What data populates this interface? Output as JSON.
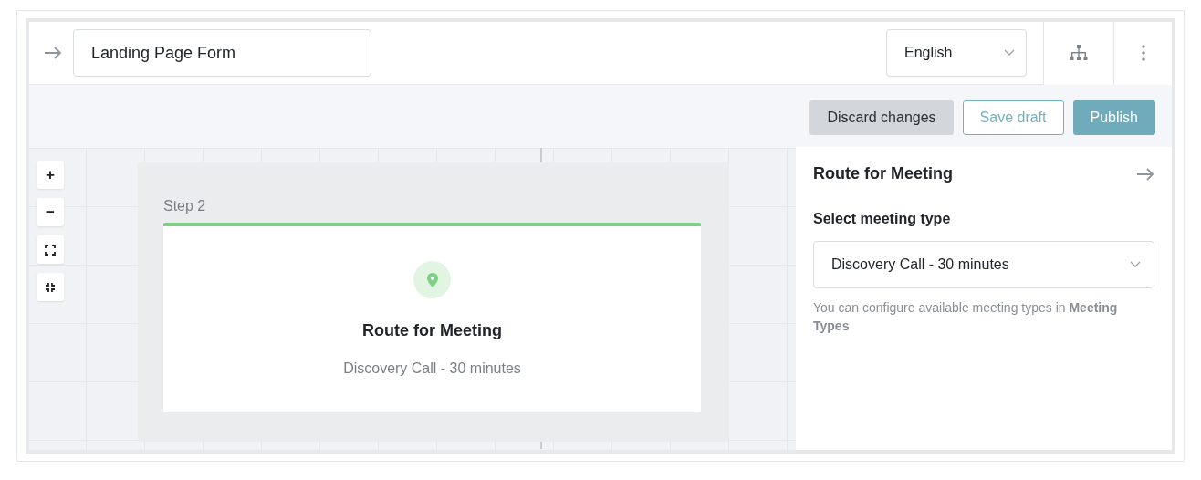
{
  "header": {
    "form_name": "Landing Page Form",
    "language": "English"
  },
  "toolbar": {
    "buttons": [
      {
        "label": "Discard changes",
        "kind": "secondary"
      },
      {
        "label": "Save draft",
        "kind": "outline"
      },
      {
        "label": "Publish",
        "kind": "primary"
      }
    ]
  },
  "canvas": {
    "zoom_controls": [
      "+",
      "−"
    ],
    "node": {
      "step": "Step 2",
      "title": "Route for Meeting",
      "subtitle": "Discovery Call - 30 minutes",
      "color": "#7dd184"
    }
  },
  "panel": {
    "title": "Route for Meeting",
    "field_label": "Select meeting type",
    "field_value": "Discovery Call - 30 minutes",
    "help": "You can configure available meeting types in **Meeting Types**"
  }
}
